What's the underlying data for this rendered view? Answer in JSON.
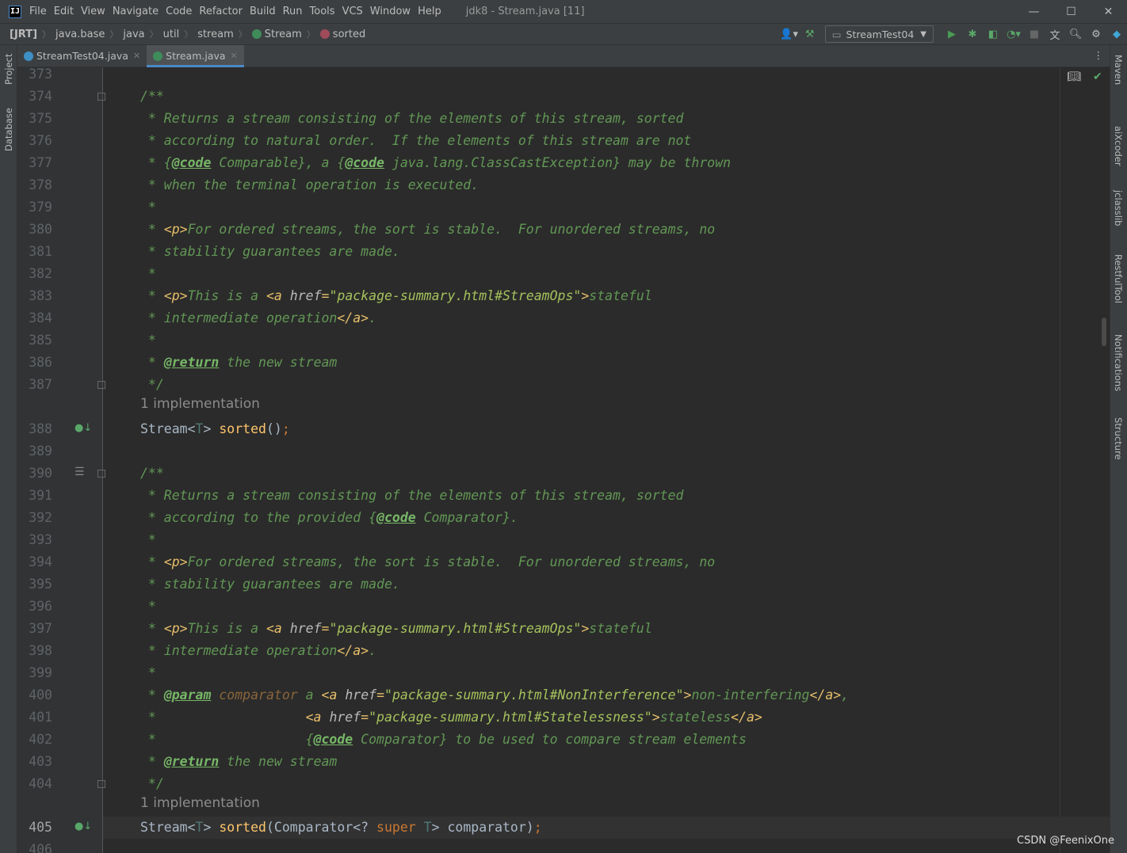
{
  "window": {
    "logo": "IJ",
    "title": "jdk8 - Stream.java [11]",
    "controls": [
      "—",
      "☐",
      "✕"
    ]
  },
  "menu": [
    "File",
    "Edit",
    "View",
    "Navigate",
    "Code",
    "Refactor",
    "Build",
    "Run",
    "Tools",
    "VCS",
    "Window",
    "Help"
  ],
  "breadcrumbs": [
    "[JRT]",
    "java.base",
    "java",
    "util",
    "stream",
    "Stream",
    "sorted"
  ],
  "toolbar": {
    "run_config": "StreamTest04"
  },
  "left_strip": {
    "project": "Project",
    "database": "Database"
  },
  "right_strip": [
    "Maven",
    "aiXcoder",
    "jclasslib",
    "RestfulTool",
    "Notifications",
    "Structure"
  ],
  "tabs": [
    {
      "label": "StreamTest04.java",
      "active": false
    },
    {
      "label": "Stream.java",
      "active": true
    }
  ],
  "editor": {
    "implementations_label": "1 implementation",
    "line_numbers": [
      "373",
      "374",
      "375",
      "376",
      "377",
      "378",
      "379",
      "380",
      "381",
      "382",
      "383",
      "384",
      "385",
      "386",
      "387",
      "388",
      "389",
      "390",
      "391",
      "392",
      "393",
      "394",
      "395",
      "396",
      "397",
      "398",
      "399",
      "400",
      "401",
      "402",
      "403",
      "404",
      "405",
      "406"
    ]
  },
  "watermark": "CSDN @FeenixOne",
  "colors": {
    "editor_bg": "#2b2b2b",
    "gutter_bg": "#313335",
    "doc_comment": "#629755",
    "doc_tag": "#77b767",
    "keyword": "#cc7832",
    "method": "#ffc66d",
    "accent": "#4a88c7"
  }
}
